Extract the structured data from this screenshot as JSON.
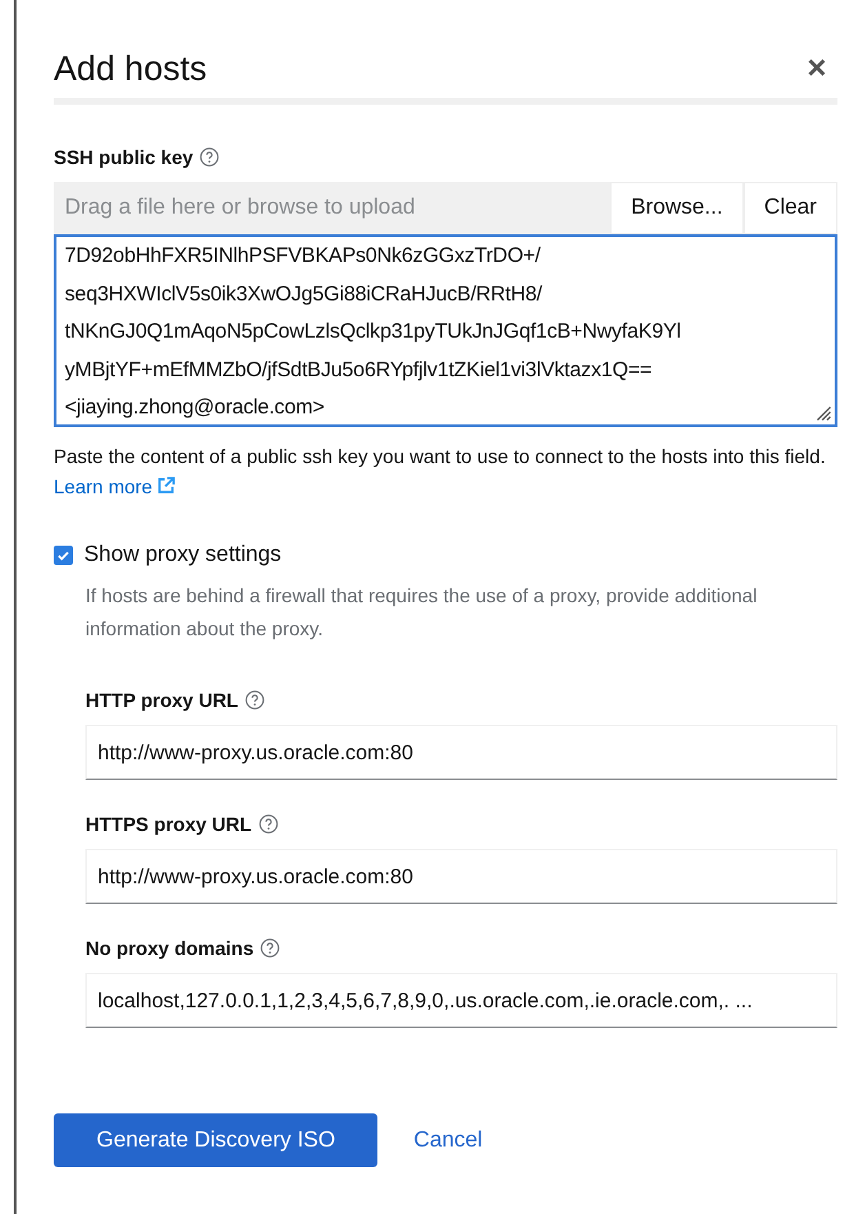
{
  "dialog": {
    "title": "Add hosts",
    "close": "×"
  },
  "ssh_key": {
    "label": "SSH public key",
    "placeholder": "Drag a file here or browse to upload",
    "buttons": [
      "Browse...",
      "Clear"
    ],
    "lines": [
      "7D92obHhFXR5INlhPSFVBKAPs0Nk6zGGxzTrDO+/",
      "seq3HXWIclV5s0ik3XwOJg5Gi88iCRaHJucB/RRtH8/",
      "tNKnGJ0Q1mAqoN5pCowLzlsQclkp31pyTUkJnJGqf1cB+NwyfaK9Yl",
      "yMBjtYF+mEfMMZbO/jfSdtBJu5o6RYpfjlv1tZKiel1vi3lVktazx1Q==",
      "<jiaying.zhong@oracle.com>"
    ],
    "help": "Paste the content of a public ssh key you want to use to connect to the hosts into this field.",
    "link": "Learn more"
  },
  "proxy_toggle": {
    "label": "Show proxy settings",
    "checked": true,
    "description": "If hosts are behind a firewall that requires the use of a proxy, provide additional information about the proxy."
  },
  "proxy_fields": [
    {
      "label": "HTTP proxy URL",
      "value": "http://www-proxy.us.oracle.com:80"
    },
    {
      "label": "HTTPS proxy URL",
      "value": "http://www-proxy.us.oracle.com:80"
    },
    {
      "label": "No proxy domains",
      "value": "localhost,127.0.0.1,1,2,3,4,5,6,7,8,9,0,.us.oracle.com,.ie.oracle.com,. ..."
    }
  ],
  "actions": {
    "primary": "Generate Discovery ISO",
    "secondary": "Cancel"
  }
}
